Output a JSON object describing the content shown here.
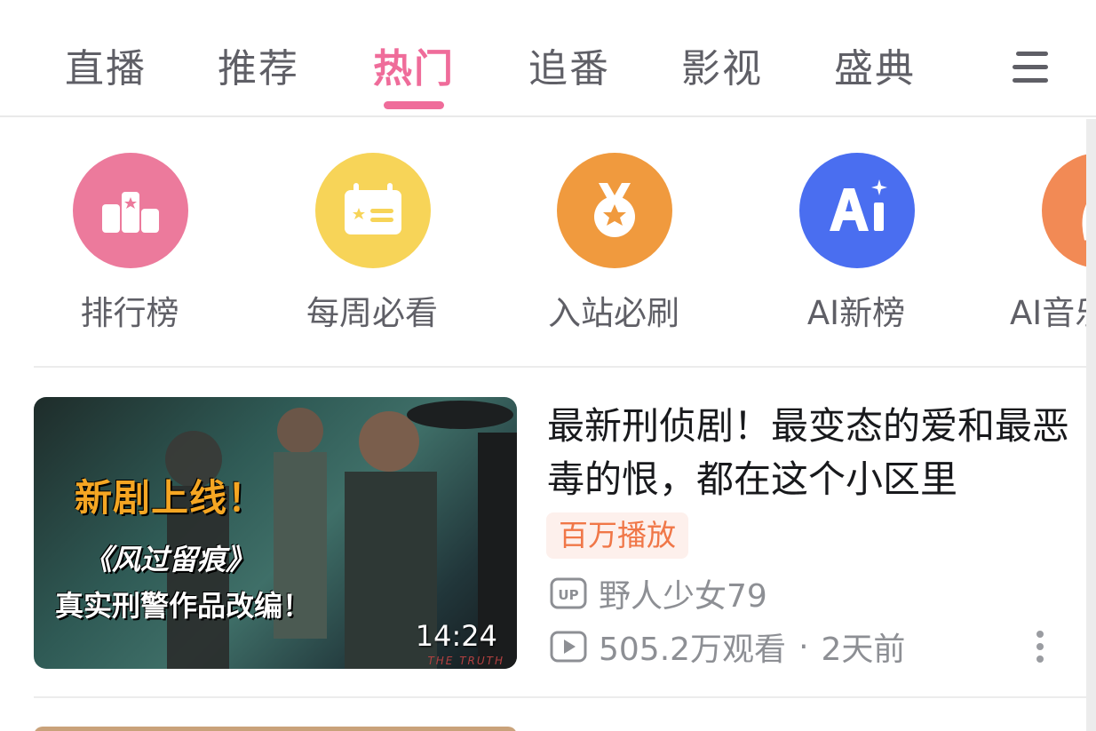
{
  "tabs": [
    {
      "label": "直播",
      "active": false
    },
    {
      "label": "推荐",
      "active": false
    },
    {
      "label": "热门",
      "active": true
    },
    {
      "label": "追番",
      "active": false
    },
    {
      "label": "影视",
      "active": false
    },
    {
      "label": "盛典",
      "active": false
    }
  ],
  "menu_icon": "menu-icon",
  "accent_color": "#ef6c9a",
  "shortcuts": [
    {
      "label": "排行榜",
      "icon": "ranking-podium-icon",
      "color": "#ec7a9c"
    },
    {
      "label": "每周必看",
      "icon": "weekly-calendar-icon",
      "color": "#f7d458"
    },
    {
      "label": "入站必刷",
      "icon": "medal-icon",
      "color": "#f09a3e"
    },
    {
      "label": "AI新榜",
      "icon": "ai-icon",
      "color": "#4a6ef0"
    },
    {
      "label": "AI音乐",
      "icon": "horse-music-icon",
      "color": "#f28a55"
    }
  ],
  "video": {
    "thumb_line1": "新剧上线！",
    "thumb_line2": "《风过留痕》",
    "thumb_line3": "真实刑警作品改编！",
    "thumb_brand": "THE TRUTH",
    "duration": "14:24",
    "title": "最新刑侦剧！最变态的爱和最恶毒的恨，都在这个小区里",
    "badge": "百万播放",
    "uploader": "野人少女79",
    "views": "505.2万观看",
    "separator": "·",
    "time_ago": "2天前"
  }
}
